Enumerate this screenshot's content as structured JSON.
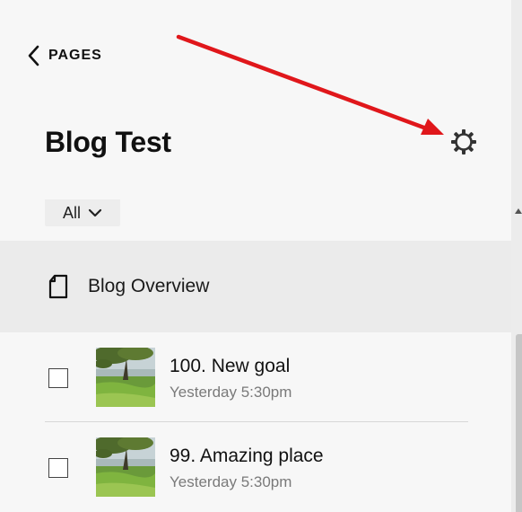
{
  "back": {
    "label": "PAGES"
  },
  "page": {
    "title": "Blog Test"
  },
  "filter": {
    "selected": "All"
  },
  "overview": {
    "label": "Blog Overview"
  },
  "posts": [
    {
      "title": "100. New goal",
      "time": "Yesterday 5:30pm"
    },
    {
      "title": "99. Amazing place",
      "time": "Yesterday 5:30pm"
    }
  ],
  "colors": {
    "annotation_arrow": "#e0171b",
    "selected_row_bg": "#ebebeb"
  },
  "icons": {
    "back": "chevron-left-icon",
    "settings": "gear-icon",
    "filter": "chevron-down-icon",
    "page": "document-icon"
  }
}
